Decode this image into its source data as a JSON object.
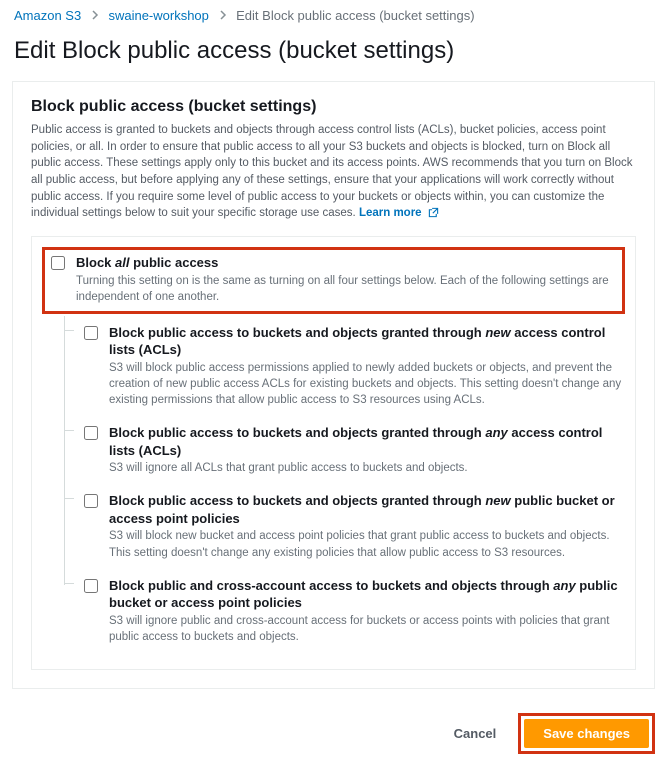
{
  "breadcrumb": {
    "root": "Amazon S3",
    "bucket": "swaine-workshop",
    "current": "Edit Block public access (bucket settings)"
  },
  "pageTitle": "Edit Block public access (bucket settings)",
  "panel": {
    "heading": "Block public access (bucket settings)",
    "description": "Public access is granted to buckets and objects through access control lists (ACLs), bucket policies, access point policies, or all. In order to ensure that public access to all your S3 buckets and objects is blocked, turn on Block all public access. These settings apply only to this bucket and its access points. AWS recommends that you turn on Block all public access, but before applying any of these settings, ensure that your applications will work correctly without public access. If you require some level of public access to your buckets or objects within, you can customize the individual settings below to suit your specific storage use cases.",
    "learnMore": "Learn more"
  },
  "blockAll": {
    "titlePrefix": "Block ",
    "titleEm": "all",
    "titleSuffix": " public access",
    "desc": "Turning this setting on is the same as turning on all four settings below. Each of the following settings are independent of one another."
  },
  "sub": [
    {
      "titlePrefix": "Block public access to buckets and objects granted through ",
      "titleEm": "new",
      "titleSuffix": " access control lists (ACLs)",
      "desc": "S3 will block public access permissions applied to newly added buckets or objects, and prevent the creation of new public access ACLs for existing buckets and objects. This setting doesn't change any existing permissions that allow public access to S3 resources using ACLs."
    },
    {
      "titlePrefix": "Block public access to buckets and objects granted through ",
      "titleEm": "any",
      "titleSuffix": " access control lists (ACLs)",
      "desc": "S3 will ignore all ACLs that grant public access to buckets and objects."
    },
    {
      "titlePrefix": "Block public access to buckets and objects granted through ",
      "titleEm": "new",
      "titleSuffix": " public bucket or access point policies",
      "desc": "S3 will block new bucket and access point policies that grant public access to buckets and objects. This setting doesn't change any existing policies that allow public access to S3 resources."
    },
    {
      "titlePrefix": "Block public and cross-account access to buckets and objects through ",
      "titleEm": "any",
      "titleSuffix": " public bucket or access point policies",
      "desc": "S3 will ignore public and cross-account access for buckets or access points with policies that grant public access to buckets and objects."
    }
  ],
  "actions": {
    "cancel": "Cancel",
    "save": "Save changes"
  }
}
